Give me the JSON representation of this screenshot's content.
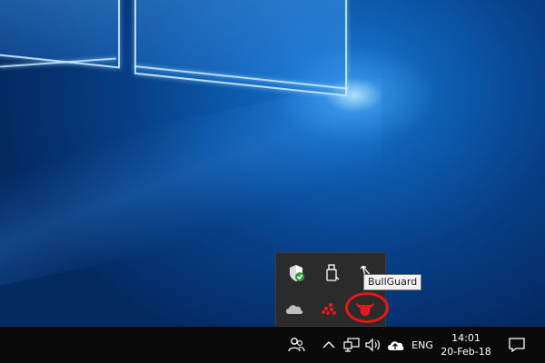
{
  "tray": {
    "tooltip": "BullGuard",
    "flyout_icons": [
      "windows-defender-icon",
      "usb-drive-icon",
      "pen-icon",
      "onedrive-icon",
      "red-dots-icon",
      "bullguard-icon"
    ]
  },
  "taskbar": {
    "language": "ENG",
    "time": "14:01",
    "date": "20-Feb-18"
  },
  "colors": {
    "taskbar_bg": "#0a0a0a",
    "flyout_bg": "#2b2b2b",
    "highlight": "#e01818",
    "bullguard_red": "#e11b1b",
    "defender_green": "#2ea043"
  }
}
